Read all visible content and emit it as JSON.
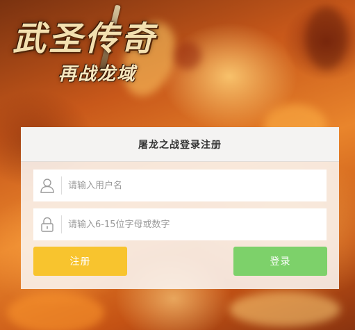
{
  "logo": {
    "title": "武圣传奇",
    "subtitle": "再战龙域"
  },
  "panel": {
    "title": "屠龙之战登录注册"
  },
  "username": {
    "placeholder": "请输入用户名",
    "value": "",
    "icon": "user-icon"
  },
  "password": {
    "placeholder": "请输入6-15位字母或数字",
    "value": "",
    "icon": "lock-icon"
  },
  "buttons": {
    "register_label": "注册",
    "login_label": "登录"
  },
  "colors": {
    "register": "#f8c42e",
    "login": "#7dd16a",
    "panel_bg": "#faf6f2",
    "background": "#d66a1e"
  }
}
